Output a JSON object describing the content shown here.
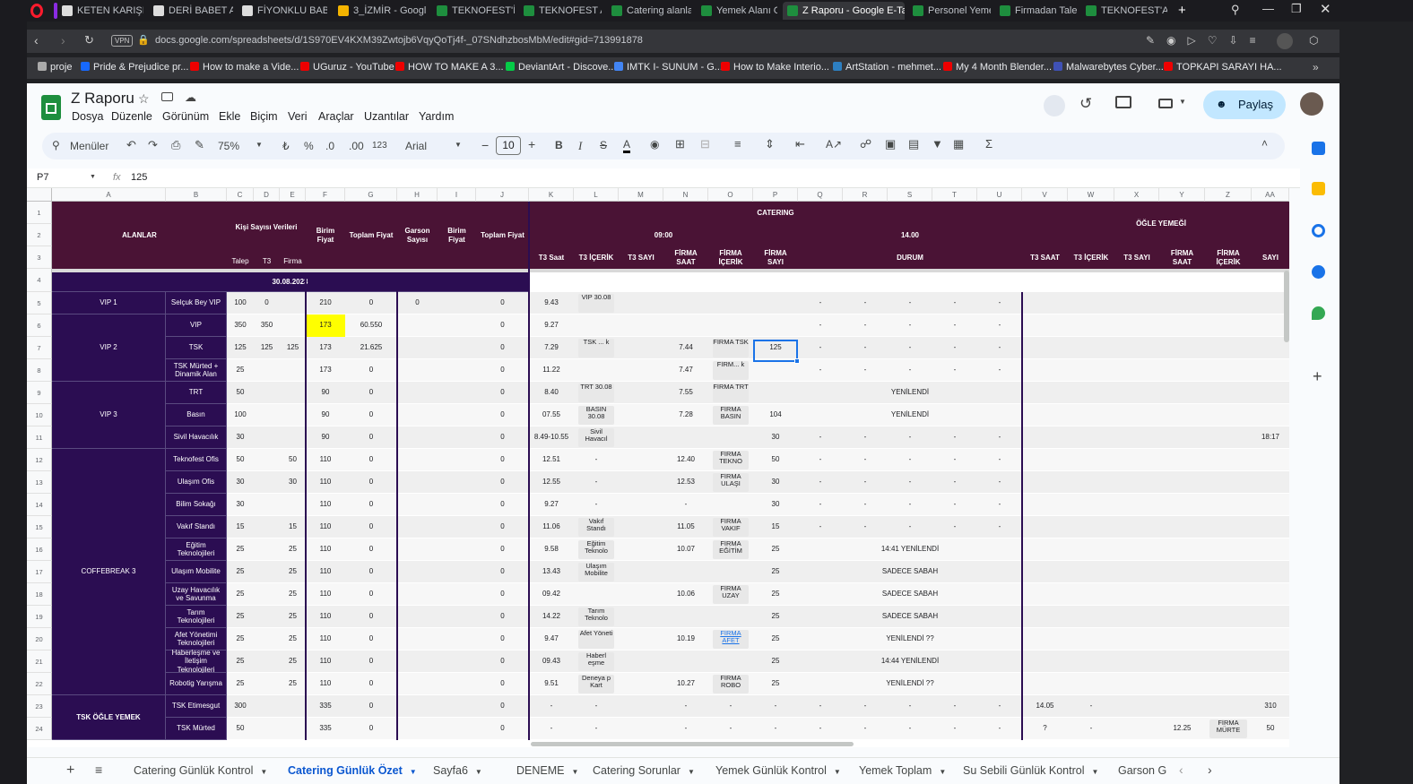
{
  "browser": {
    "tabs": [
      {
        "label": "KETEN KARIŞIMI"
      },
      {
        "label": "DERİ BABET AYA"
      },
      {
        "label": "FİYONKLU BABE"
      },
      {
        "label": "3_İZMİR - Googl"
      },
      {
        "label": "TEKNOFEST'İZMİ"
      },
      {
        "label": "TEKNOFEST ANI"
      },
      {
        "label": "Catering alanlar"
      },
      {
        "label": "Yemek Alanı Gö"
      },
      {
        "label": "Z Raporu - Google E-Tabl"
      },
      {
        "label": "Personel Yemek"
      },
      {
        "label": "Firmadan Talepl"
      },
      {
        "label": "TEKNOFEST'ANI"
      }
    ],
    "url": "docs.google.com/spreadsheets/d/1S970EV4KXM39Zwtojb6VqyQoTj4f-_07SNdhzbosMbM/edit#gid=713991878",
    "vpn": "VPN",
    "bookmarks": [
      "proje",
      "Pride & Prejudice pr...",
      "How to make a Vide...",
      "UGuruz - YouTube",
      "HOW TO MAKE A 3...",
      "DeviantArt - Discove...",
      "IMTK I- SUNUM - G...",
      "How to Make Interio...",
      "ArtStation - mehmet...",
      "My 4 Month Blender...",
      "Malwarebytes Cyber...",
      "TOPKAPI SARAYI HA..."
    ]
  },
  "doc": {
    "title": "Z Raporu",
    "menus": [
      "Dosya",
      "Düzenle",
      "Görünüm",
      "Ekle",
      "Biçim",
      "Veri",
      "Araçlar",
      "Uzantılar",
      "Yardım"
    ],
    "share": "Paylaş"
  },
  "toolbar": {
    "search": "Menüler",
    "zoom": "75%",
    "currency": "₺",
    "percent": "%",
    "dec_less": ".0",
    "dec_more": ".00",
    "fmt": "123",
    "font": "Arial",
    "size": "10"
  },
  "formula": {
    "cell": "P7",
    "fx": "fx",
    "value": "125"
  },
  "columns": [
    "A",
    "B",
    "C",
    "D",
    "E",
    "F",
    "G",
    "H",
    "I",
    "J",
    "K",
    "L",
    "M",
    "N",
    "O",
    "P",
    "Q",
    "R",
    "S",
    "T",
    "U",
    "V",
    "W",
    "X",
    "Y",
    "Z",
    "AA"
  ],
  "headers": {
    "alanlar": "ALANLAR",
    "kisi": "Kişi Sayısı Verileri",
    "talep": "Talep",
    "t3": "T3",
    "firma": "Firma",
    "birim": "Birim Fiyat",
    "toplam": "Toplam Fiyat",
    "garson": "Garson Sayısı",
    "birim2": "Birim Fiyat",
    "toplam2": "Toplam Fiyat",
    "catering": "CATERING",
    "t0900": "09:00",
    "t1400": "14.00",
    "ogle": "ÖĞLE YEMEĞİ",
    "t3saat": "T3 Saat",
    "t3icerik": "T3 İÇERİK",
    "t3sayi": "T3 SAYI",
    "firmasaat": "FİRMA SAAT",
    "firmaicerik": "FİRMA İÇERİK",
    "firmasayi": "FİRMA SAYI",
    "durum": "DURUM",
    "v": "T3 SAAT",
    "w": "T3 İÇERİK",
    "x": "T3 SAYI",
    "y": "FİRMA SAAT",
    "z": "FİRMA İÇERİK",
    "aa": "SAYI",
    "date": "30.08.2023"
  },
  "groups": [
    "VIP 1",
    "VIP 2",
    "VIP 3",
    "COFFEBREAK 3",
    "TSK ÖĞLE YEMEK"
  ],
  "rows": [
    {
      "n": "5",
      "b": "Selçuk Bey VIP",
      "c": "100",
      "d": "0",
      "e": "",
      "f": "210",
      "g": "0",
      "h": "0",
      "j": "0",
      "k": "9.43",
      "l": "VİP 30.08",
      "n2": "",
      "o": "",
      "p": "",
      "q": "-",
      "r": "-",
      "s": "-",
      "t": "-",
      "u": "-",
      "v": "",
      "w": "",
      "y": "",
      "z": "",
      "aa": ""
    },
    {
      "n": "6",
      "b": "VIP",
      "c": "350",
      "d": "350",
      "e": "",
      "f": "173",
      "g": "60.550",
      "h": "",
      "j": "0",
      "k": "9.27",
      "l": "",
      "n2": "",
      "o": "",
      "p": "",
      "q": "-",
      "r": "-",
      "s": "-",
      "t": "-",
      "u": "-",
      "v": "",
      "w": "",
      "y": "",
      "z": "",
      "aa": ""
    },
    {
      "n": "7",
      "b": "TSK",
      "c": "125",
      "d": "125",
      "e": "125",
      "f": "173",
      "g": "21.625",
      "h": "",
      "j": "0",
      "k": "7.29",
      "l": "TSK ... k",
      "n2": "7.44",
      "o": "FİRMA TSK",
      "p": "125",
      "q": "-",
      "r": "-",
      "s": "-",
      "t": "-",
      "u": "-",
      "v": "",
      "w": "",
      "y": "",
      "z": "",
      "aa": ""
    },
    {
      "n": "8",
      "b": "TSK Mürted + Dinamik Alan",
      "c": "25",
      "d": "",
      "e": "",
      "f": "173",
      "g": "0",
      "h": "",
      "j": "0",
      "k": "11.22",
      "l": "",
      "n2": "7.47",
      "o": "FİRM... k",
      "p": "",
      "q": "-",
      "r": "-",
      "s": "-",
      "t": "-",
      "u": "-",
      "v": "",
      "w": "",
      "y": "",
      "z": "",
      "aa": ""
    },
    {
      "n": "9",
      "b": "TRT",
      "c": "50",
      "d": "",
      "e": "",
      "f": "90",
      "g": "0",
      "h": "",
      "j": "0",
      "k": "8.40",
      "l": "TRT 30.08",
      "n2": "7.55",
      "o": "FİRMA TRT",
      "p": "",
      "durum": "YENİLENDİ",
      "v": "",
      "w": "",
      "y": "",
      "z": "",
      "aa": ""
    },
    {
      "n": "10",
      "b": "Basın",
      "c": "100",
      "d": "",
      "e": "",
      "f": "90",
      "g": "0",
      "h": "",
      "j": "0",
      "k": "07.55",
      "l": "BASIN 30.08",
      "n2": "7.28",
      "o": "FİRMA BASIN",
      "p": "104",
      "durum": "YENİLENDİ",
      "v": "",
      "w": "",
      "y": "",
      "z": "",
      "aa": ""
    },
    {
      "n": "11",
      "b": "Sivil Havacılık",
      "c": "30",
      "d": "",
      "e": "",
      "f": "90",
      "g": "0",
      "h": "",
      "j": "0",
      "k": "8.49-10.55",
      "l": "Sivil Havacıl",
      "n2": "",
      "o": "",
      "p": "30",
      "q": "-",
      "r": "-",
      "s": "-",
      "t": "-",
      "u": "-",
      "v": "",
      "w": "",
      "y": "",
      "z": "",
      "aa": "18:17"
    },
    {
      "n": "12",
      "b": "Teknofest Ofis",
      "c": "50",
      "d": "",
      "e": "50",
      "f": "110",
      "g": "0",
      "h": "",
      "j": "0",
      "k": "12.51",
      "l": "-",
      "n2": "12.40",
      "o": "FİRMA TEKNO",
      "p": "50",
      "q": "-",
      "r": "-",
      "s": "-",
      "t": "-",
      "u": "-",
      "v": "",
      "w": "",
      "y": "",
      "z": "",
      "aa": ""
    },
    {
      "n": "13",
      "b": "Ulaşım Ofis",
      "c": "30",
      "d": "",
      "e": "30",
      "f": "110",
      "g": "0",
      "h": "",
      "j": "0",
      "k": "12.55",
      "l": "-",
      "n2": "12.53",
      "o": "FİRMA ULAŞI",
      "p": "30",
      "q": "-",
      "r": "-",
      "s": "-",
      "t": "-",
      "u": "-",
      "v": "",
      "w": "",
      "y": "",
      "z": "",
      "aa": ""
    },
    {
      "n": "14",
      "b": "Bilim Sokağı",
      "c": "30",
      "d": "",
      "e": "",
      "f": "110",
      "g": "0",
      "h": "",
      "j": "0",
      "k": "9.27",
      "l": "-",
      "n2": "-",
      "o": "",
      "p": "30",
      "q": "-",
      "r": "-",
      "s": "-",
      "t": "-",
      "u": "-",
      "v": "",
      "w": "",
      "y": "",
      "z": "",
      "aa": ""
    },
    {
      "n": "15",
      "b": "Vakıf Standı",
      "c": "15",
      "d": "",
      "e": "15",
      "f": "110",
      "g": "0",
      "h": "",
      "j": "0",
      "k": "11.06",
      "l": "Vakıf Standı",
      "n2": "11.05",
      "o": "FİRMA VAKIF",
      "p": "15",
      "q": "-",
      "r": "-",
      "s": "-",
      "t": "-",
      "u": "-",
      "v": "",
      "w": "",
      "y": "",
      "z": "",
      "aa": ""
    },
    {
      "n": "16",
      "b": "Eğitim Teknolojileri",
      "c": "25",
      "d": "",
      "e": "25",
      "f": "110",
      "g": "0",
      "h": "",
      "j": "0",
      "k": "9.58",
      "l": "Eğitim Teknolo",
      "n2": "10.07",
      "o": "FİRMA EĞİTİM",
      "p": "25",
      "durum": "14:41 YENİLENDİ",
      "v": "",
      "w": "",
      "y": "",
      "z": "",
      "aa": ""
    },
    {
      "n": "17",
      "b": "Ulaşım Mobilite",
      "c": "25",
      "d": "",
      "e": "25",
      "f": "110",
      "g": "0",
      "h": "",
      "j": "0",
      "k": "13.43",
      "l": "Ulaşım Mobilite",
      "n2": "",
      "o": "",
      "p": "25",
      "durum": "SADECE SABAH",
      "v": "",
      "w": "",
      "y": "",
      "z": "",
      "aa": ""
    },
    {
      "n": "18",
      "b": "Uzay Havacılık ve Savunma",
      "c": "25",
      "d": "",
      "e": "25",
      "f": "110",
      "g": "0",
      "h": "",
      "j": "0",
      "k": "09.42",
      "l": "",
      "n2": "10.06",
      "o": "FİRMA UZAY",
      "p": "25",
      "durum": "SADECE SABAH",
      "v": "",
      "w": "",
      "y": "",
      "z": "",
      "aa": ""
    },
    {
      "n": "19",
      "b": "Tarım Teknolojileri",
      "c": "25",
      "d": "",
      "e": "25",
      "f": "110",
      "g": "0",
      "h": "",
      "j": "0",
      "k": "14.22",
      "l": "Tarım Teknolo",
      "n2": "",
      "o": "",
      "p": "25",
      "durum": "SADECE SABAH",
      "v": "",
      "w": "",
      "y": "",
      "z": "",
      "aa": ""
    },
    {
      "n": "20",
      "b": "Afet Yönetimi Teknolojileri",
      "c": "25",
      "d": "",
      "e": "25",
      "f": "110",
      "g": "0",
      "h": "",
      "j": "0",
      "k": "9.47",
      "l": "Afet Yöneti",
      "n2": "10.19",
      "o": "FİRMA AFET",
      "p": "25",
      "durum": "YENİLENDİ ??",
      "v": "",
      "w": "",
      "y": "",
      "z": "",
      "aa": ""
    },
    {
      "n": "21",
      "b": "Haberleşme ve İletişim Teknolojileri",
      "c": "25",
      "d": "",
      "e": "25",
      "f": "110",
      "g": "0",
      "h": "",
      "j": "0",
      "k": "09.43",
      "l": "Haberl eşme",
      "n2": "",
      "o": "",
      "p": "25",
      "durum": "14:44 YENİLENDİ",
      "v": "",
      "w": "",
      "y": "",
      "z": "",
      "aa": ""
    },
    {
      "n": "22",
      "b": "Robotig Yarışma",
      "c": "25",
      "d": "",
      "e": "25",
      "f": "110",
      "g": "0",
      "h": "",
      "j": "0",
      "k": "9.51",
      "l": "Deneya p Kart",
      "n2": "10.27",
      "o": "FİRMA ROBO",
      "p": "25",
      "durum": "YENİLENDİ ??",
      "v": "",
      "w": "",
      "y": "",
      "z": "",
      "aa": ""
    },
    {
      "n": "23",
      "b": "TSK Etimesgut",
      "c": "300",
      "d": "",
      "e": "",
      "f": "335",
      "g": "0",
      "h": "",
      "j": "0",
      "k": "-",
      "l": "-",
      "n2": "-",
      "o": "-",
      "p": "-",
      "q": "-",
      "r": "-",
      "s": "-",
      "t": "-",
      "u": "-",
      "v": "14.05",
      "w": "-",
      "y": "",
      "z": "",
      "aa": "310"
    },
    {
      "n": "24",
      "b": "TSK Mürted",
      "c": "50",
      "d": "",
      "e": "",
      "f": "335",
      "g": "0",
      "h": "",
      "j": "0",
      "k": "-",
      "l": "-",
      "n2": "-",
      "o": "-",
      "p": "-",
      "q": "-",
      "r": "-",
      "s": "-",
      "t": "-",
      "u": "-",
      "v": "?",
      "w": "-",
      "y": "12.25",
      "z": "FİRMA MÜRTE",
      "aa": "50"
    }
  ],
  "sheets": [
    "Catering Günlük Kontrol",
    "Catering Günlük Özet",
    "Sayfa6",
    "DENEME",
    "Catering Sorunlar",
    "Yemek Günlük Kontrol",
    "Yemek Toplam",
    "Su Sebili Günlük Kontrol",
    "Garson G"
  ],
  "colors": {
    "header": "#4a1335",
    "nav": "#2b0d52",
    "highlight": "#ffff00",
    "selection": "#1a73e8"
  }
}
